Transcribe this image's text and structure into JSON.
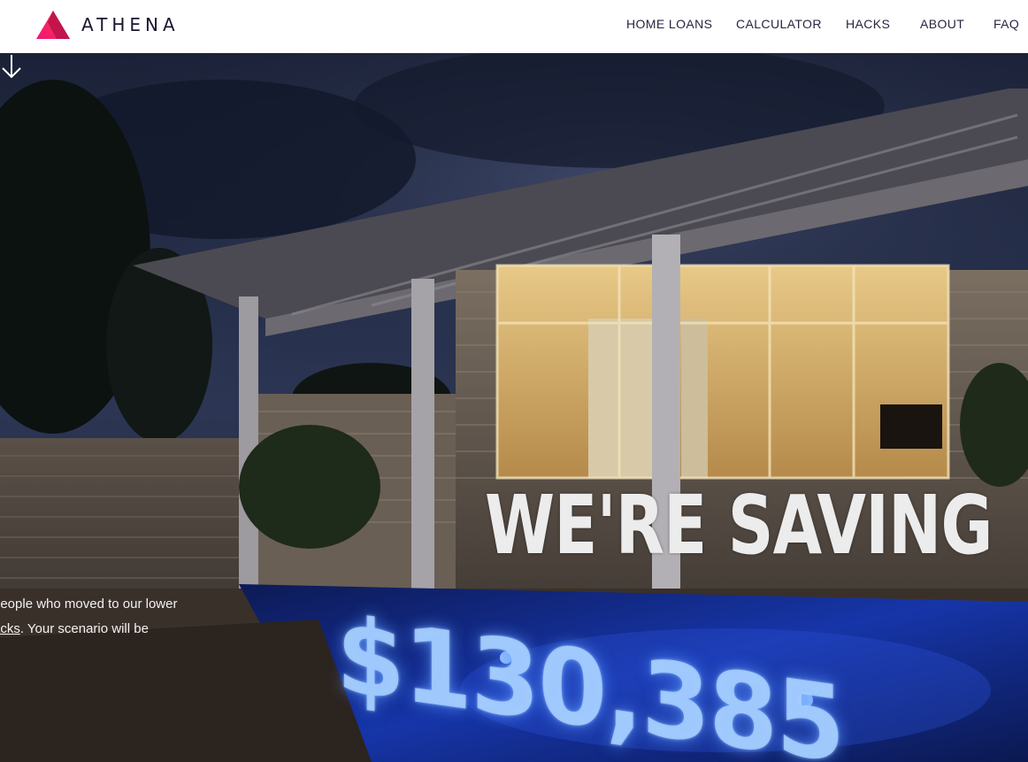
{
  "header": {
    "brand": "ATHENA",
    "nav": [
      "HOME LOANS",
      "CALCULATOR",
      "HACKS",
      "ABOUT",
      "FAQ"
    ]
  },
  "hero": {
    "text_line1": "people who moved to our lower",
    "text_link": "acks",
    "text_line2_rest": ". Your scenario will be",
    "projection_words": "WE'RE SAVING",
    "projection_amount": "$130,385"
  },
  "colors": {
    "logo_gradient": [
      "#f0147a",
      "#c2185b",
      "#ff3d3d"
    ],
    "header_bg": "#ffffff",
    "nav_text": "#2a2440"
  },
  "icons": {
    "logo": "athena-triangle-logo",
    "scroll": "arrow-down-icon"
  }
}
